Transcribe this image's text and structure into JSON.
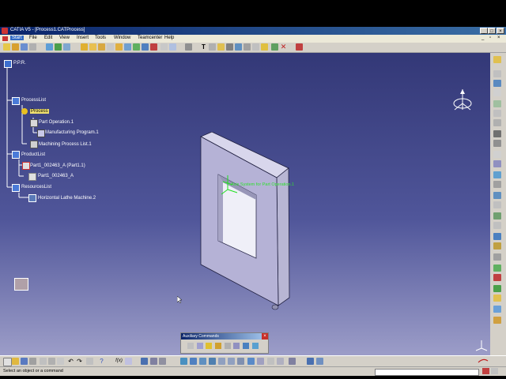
{
  "window": {
    "title": "CATIA V5 - [Process1.CATProcess]"
  },
  "menu": {
    "items": [
      "Start",
      "File",
      "Edit",
      "View",
      "Insert",
      "Tools",
      "Window",
      "Teamcenter",
      "Help"
    ]
  },
  "tree": {
    "root": "P.P.R.",
    "process_list": "ProcessList",
    "process": "Process",
    "part_operation": "Part Operation.1",
    "manufacturing_program": "Manufacturing Program.1",
    "machining_process_list": "Machining Process List.1",
    "product_list": "ProductList",
    "part1_instance": "Part1_002463_A (Part1.1)",
    "part1": "Part1_002463_A",
    "resources_list": "ResourcesList",
    "lathe_machine": "Horizontal Lathe Machine.2"
  },
  "viewport": {
    "axis_label": "Axis System for Part Operation.1"
  },
  "aux_toolbar": {
    "title": "Auxiliary Commands"
  },
  "status": {
    "prompt": "Select an object or a command"
  },
  "colors": {
    "title_bar": "#0a246a",
    "viewport_top": "#333877",
    "viewport_bottom": "#9c9dc8",
    "highlight": "#f0e070"
  }
}
